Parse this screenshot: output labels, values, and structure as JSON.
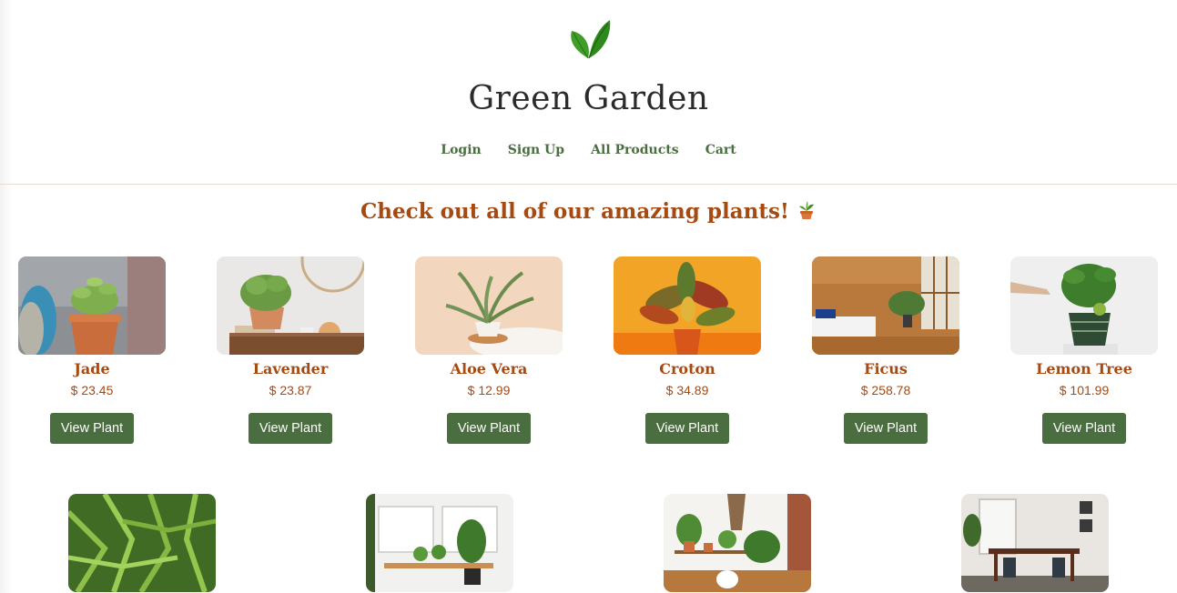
{
  "site": {
    "title": "Green Garden",
    "logo_icon": "leaf-icon",
    "nav": [
      "Login",
      "Sign Up",
      "All Products",
      "Cart"
    ]
  },
  "page": {
    "heading": "Check out all of our amazing plants!",
    "heading_icon": "potted-plant-icon"
  },
  "products": [
    {
      "name": "Jade",
      "price": "$ 23.45",
      "button": "View Plant"
    },
    {
      "name": "Lavender",
      "price": "$ 23.87",
      "button": "View Plant"
    },
    {
      "name": "Aloe Vera",
      "price": "$ 12.99",
      "button": "View Plant"
    },
    {
      "name": "Croton",
      "price": "$ 34.89",
      "button": "View Plant"
    },
    {
      "name": "Ficus",
      "price": "$ 258.78",
      "button": "View Plant"
    },
    {
      "name": "Lemon Tree",
      "price": "$ 101.99",
      "button": "View Plant"
    }
  ],
  "colors": {
    "brand_green": "#4a6e3f",
    "accent_orange": "#a64a12",
    "title_dark": "#2b2b2b"
  }
}
